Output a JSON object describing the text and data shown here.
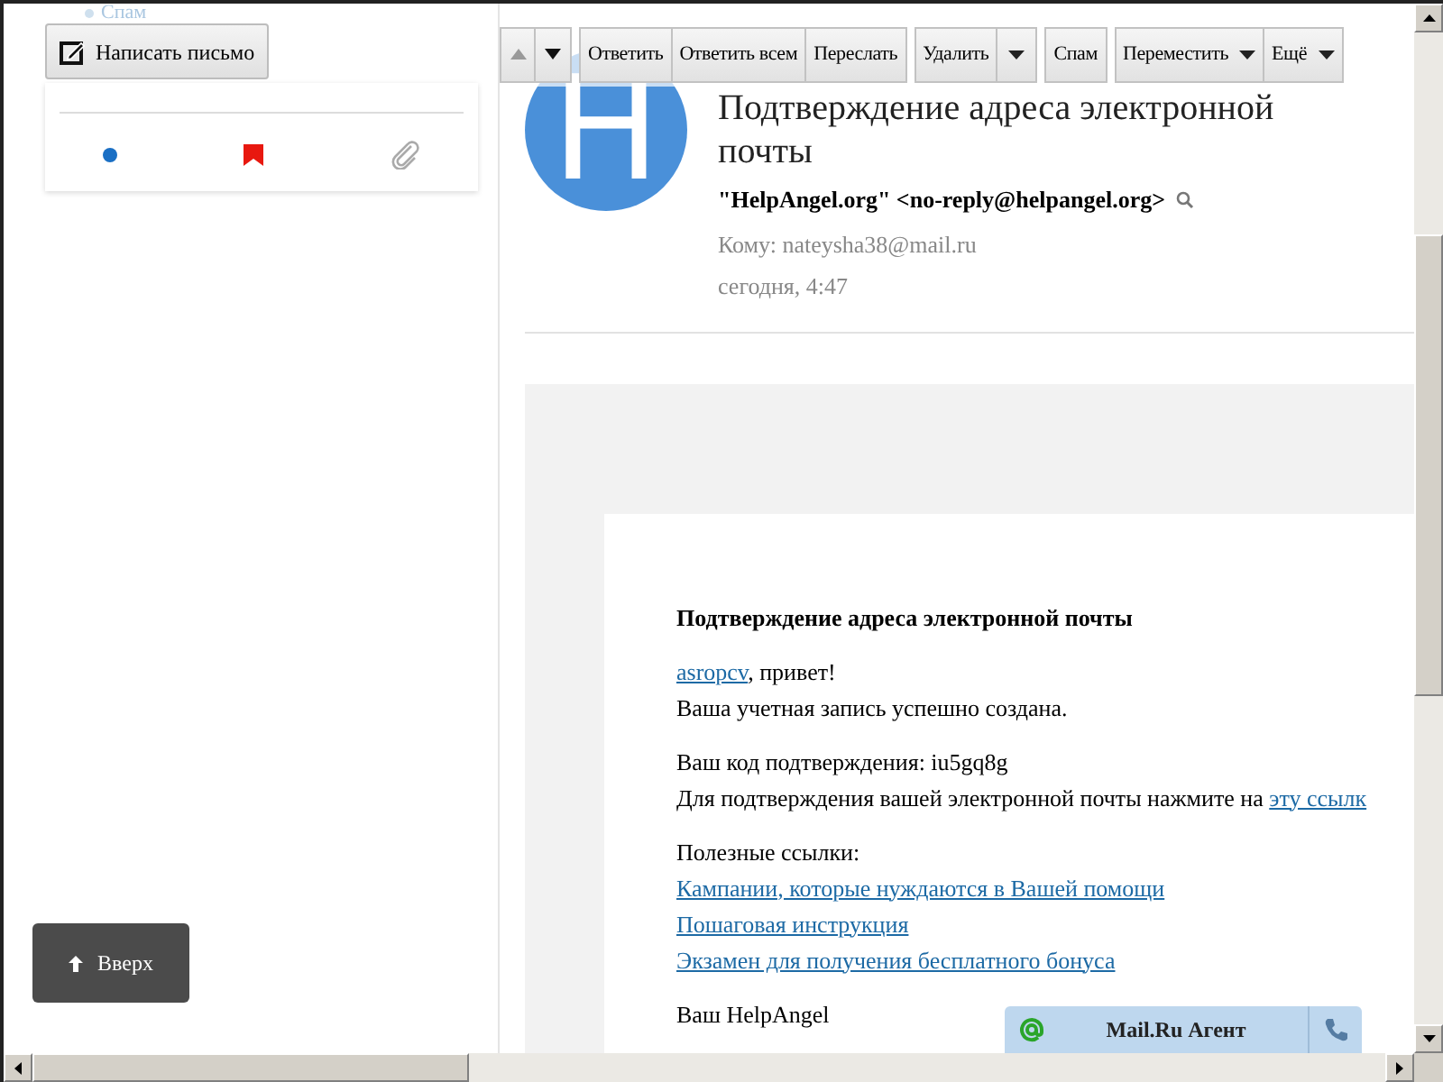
{
  "sidebar": {
    "folder_above": {
      "label": "Спам"
    },
    "compose_button": {
      "label": "Написать письмо"
    }
  },
  "toolbar": {
    "nav": [
      {
        "kind": "previous",
        "disabled": true
      },
      {
        "kind": "next",
        "disabled": false
      }
    ],
    "groups": [
      [
        {
          "label": "Ответить"
        },
        {
          "label": "Ответить всем"
        },
        {
          "label": "Переслать"
        }
      ],
      [
        {
          "label": "Удалить",
          "split_menu": true
        }
      ],
      [
        {
          "label": "Спам"
        }
      ],
      [
        {
          "label": "Переместить",
          "menu": true
        },
        {
          "label": "Ещё",
          "menu": true
        }
      ]
    ]
  },
  "message": {
    "avatar_letter": "H",
    "subject": "Подтверждение адреса электронной почты",
    "sender_name": "\"HelpAngel.org\"",
    "sender_email": "<no-reply@helpangel.org>",
    "to": "Кому: nateysha38@mail.ru",
    "date": "сегодня, 4:47",
    "body": [
      {
        "kind": "heading",
        "lines": [
          [
            {
              "text": "Подтверждение адреса электронной почты",
              "link": false
            }
          ]
        ]
      },
      {
        "kind": "paragraph",
        "lines": [
          [
            {
              "text": "asropcv",
              "link": true
            },
            {
              "text": ", привет!",
              "link": false
            }
          ],
          [
            {
              "text": "Ваша учетная запись успешно создана.",
              "link": false
            }
          ]
        ]
      },
      {
        "kind": "paragraph",
        "lines": [
          [
            {
              "text": "Ваш код подтверждения: iu5gq8g",
              "link": false
            }
          ],
          [
            {
              "text": "Для подтверждения вашей электронной почты нажмите на ",
              "link": false
            },
            {
              "text": "эту ссылк",
              "link": true
            }
          ]
        ]
      },
      {
        "kind": "paragraph",
        "lines": [
          [
            {
              "text": "Полезные ссылки:",
              "link": false
            }
          ],
          [
            {
              "text": "Кампании, которые нуждаются в Вашей помощи",
              "link": true
            }
          ],
          [
            {
              "text": "Пошаговая инструкция",
              "link": true
            }
          ],
          [
            {
              "text": "Экзамен для получения бесплатного бонуса",
              "link": true
            }
          ]
        ]
      },
      {
        "kind": "paragraph",
        "lines": [
          [
            {
              "text": "Ваш HelpAngel",
              "link": false
            }
          ]
        ]
      }
    ]
  },
  "back_to_top": {
    "label": "Вверх"
  },
  "agent_bar": {
    "label": "Mail.Ru Агент"
  }
}
